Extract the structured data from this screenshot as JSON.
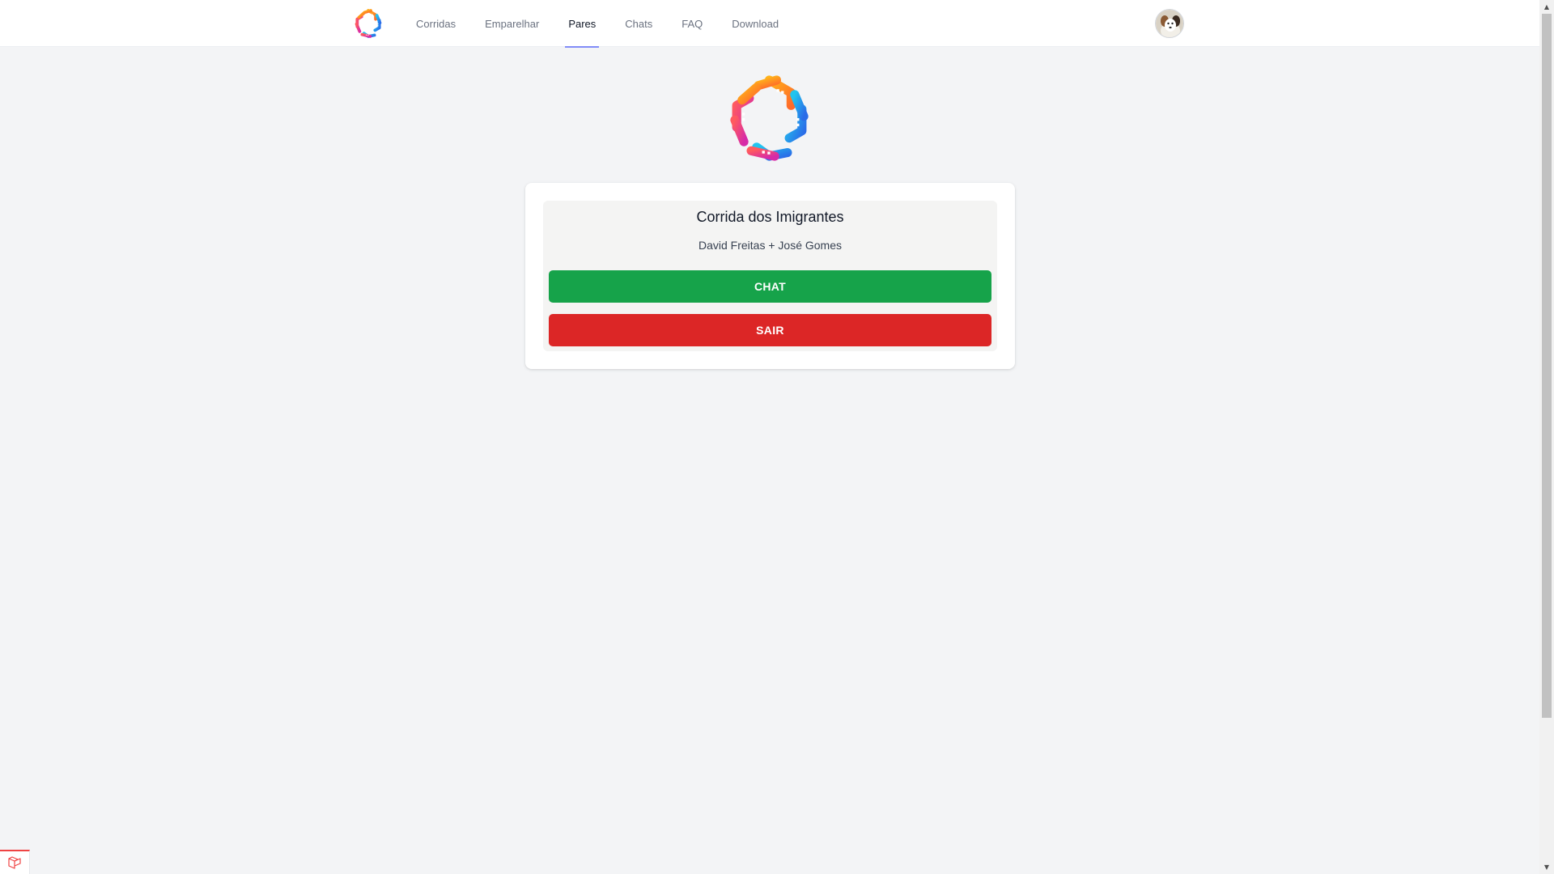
{
  "nav": {
    "logo_icon": "app-logo-icon",
    "links": [
      {
        "label": "Corridas",
        "active": false
      },
      {
        "label": "Emparelhar",
        "active": false
      },
      {
        "label": "Pares",
        "active": true
      },
      {
        "label": "Chats",
        "active": false
      },
      {
        "label": "FAQ",
        "active": false
      },
      {
        "label": "Download",
        "active": false
      }
    ],
    "active_underline_color": "#818cf8",
    "avatar_icon": "user-avatar"
  },
  "main": {
    "logo_icon": "app-logo-icon",
    "pair": {
      "title": "Corrida dos Imigrantes",
      "names": "David Freitas + José Gomes",
      "chat_label": "CHAT",
      "leave_label": "SAIR"
    }
  },
  "colors": {
    "background": "#f3f4f6",
    "chat_button": "#16a34a",
    "leave_button": "#dc2626"
  },
  "debug": {
    "icon": "laravel-debugbar-icon"
  }
}
